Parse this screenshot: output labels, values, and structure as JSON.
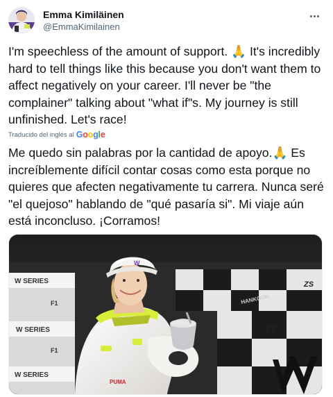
{
  "tweet": {
    "author": {
      "name": "Emma Kimiläinen",
      "handle": "@EmmaKimilainen"
    },
    "more_icon": "more-horizontal-icon",
    "text": "I'm speechless of the amount of support. 🙏 It's incredibly hard to tell things like this because you don't want them to affect negatively on your career. I'll never be \"the complainer\" talking about \"what if\"s. My journey is still unfinished. Let's race!",
    "translation": {
      "label": "Traducido del inglés al",
      "provider": "Google",
      "text": "Me quedo sin palabras por la cantidad de apoyo.🙏 Es increíblemente difícil contar cosas como esta porque no quieres que afecten negativamente tu carrera. Nunca seré \"el quejoso\" hablando de \"qué pasaría si\". Mi viaje aún está inconcluso. ¡Corramos!"
    },
    "media": {
      "banner_texts": [
        "W SERIES",
        "F1",
        "W SERIES",
        "F1",
        "W SERIES"
      ],
      "sponsor_text": "HANKOOK",
      "race_logo": "ZS",
      "cap_logo": "W",
      "suit_brand": "PUMA"
    }
  },
  "colors": {
    "text": "#0f1419",
    "secondary": "#536471",
    "google_blue": "#4285F4",
    "google_red": "#EA4335",
    "google_yellow": "#FBBC05",
    "google_green": "#34A853",
    "suit": "#f1efec",
    "hivis": "#d9ee3a"
  }
}
